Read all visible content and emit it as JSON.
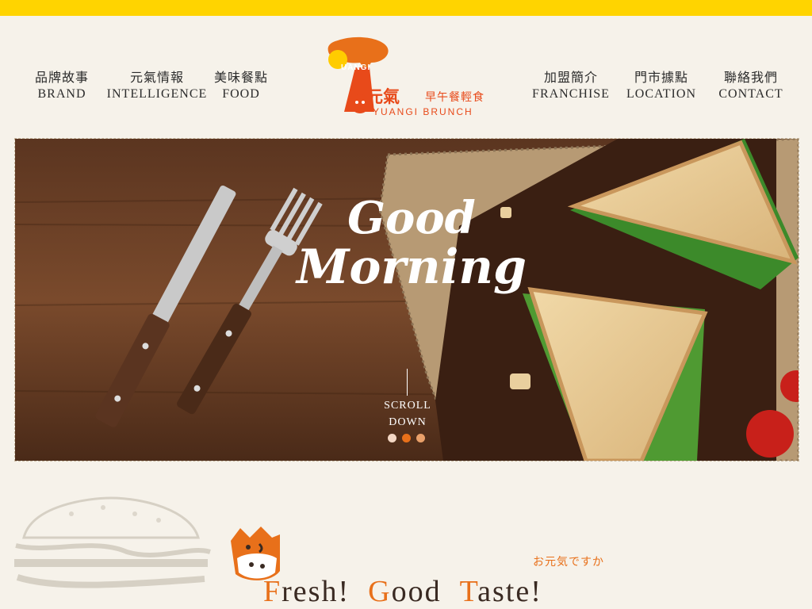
{
  "colors": {
    "accent": "#e84a1a",
    "topbar": "#ffd400",
    "dot_active": "#e8701a",
    "dot_inactive": "#f3d7c4"
  },
  "nav": {
    "left": [
      {
        "zh": "品牌故事",
        "en": "BRAND"
      },
      {
        "zh": "元氣情報",
        "en": "INTELLIGENCE"
      },
      {
        "zh": "美味餐點",
        "en": "FOOD"
      }
    ],
    "right": [
      {
        "zh": "加盟簡介",
        "en": "FRANCHISE"
      },
      {
        "zh": "門市據點",
        "en": "LOCATION"
      },
      {
        "zh": "聯絡我們",
        "en": "CONTACT"
      }
    ]
  },
  "logo": {
    "uangi": "UANGI",
    "name_zh": "元氣",
    "sub_zh": "早午餐輕食",
    "name_en": "YUANGI BRUNCH"
  },
  "hero": {
    "title_line1": "Good",
    "title_line2": "Morning",
    "scroll_label_1": "SCROLL",
    "scroll_label_2": "DOWN",
    "slides_total": 3,
    "slide_active": 2
  },
  "intro": {
    "jp_text": "お元気ですか",
    "headline": [
      {
        "cap": "F",
        "rest": "resh!"
      },
      {
        "cap": "G",
        "rest": "ood"
      },
      {
        "cap": "T",
        "rest": "aste!"
      }
    ]
  }
}
